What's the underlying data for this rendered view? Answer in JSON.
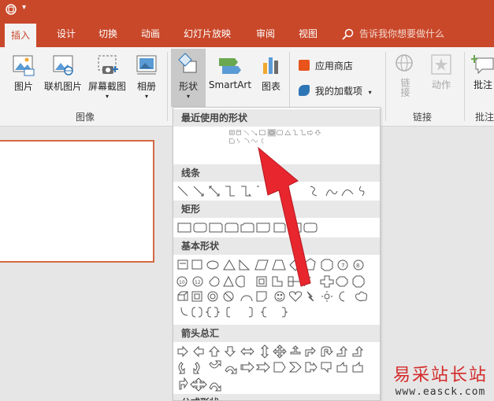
{
  "tabs": [
    "插入",
    "设计",
    "切换",
    "动画",
    "幻灯片放映",
    "审阅",
    "视图"
  ],
  "tell_me": "告诉我你想要做什么",
  "ribbon": {
    "image_group": {
      "pictures": "图片",
      "online_pictures": "联机图片",
      "screenshot": "屏幕截图",
      "album": "相册",
      "label": "图像"
    },
    "shapes": "形状",
    "smartart": "SmartArt",
    "chart": "图表",
    "store": "应用商店",
    "my_addins": "我的加载项",
    "link": "链接",
    "action": "动作",
    "links_label": "链接",
    "comment": "批注",
    "comments_label": "批注"
  },
  "gallery": {
    "recent": "最近使用的形状",
    "lines": "线条",
    "rectangles": "矩形",
    "basic": "基本形状",
    "arrows": "箭头总汇",
    "formula": "公式形状"
  },
  "watermark": {
    "name": "易采站长站",
    "url": "www.easck.com"
  },
  "colors": {
    "brand": "#c9482a",
    "arrow": "#e8262e"
  }
}
